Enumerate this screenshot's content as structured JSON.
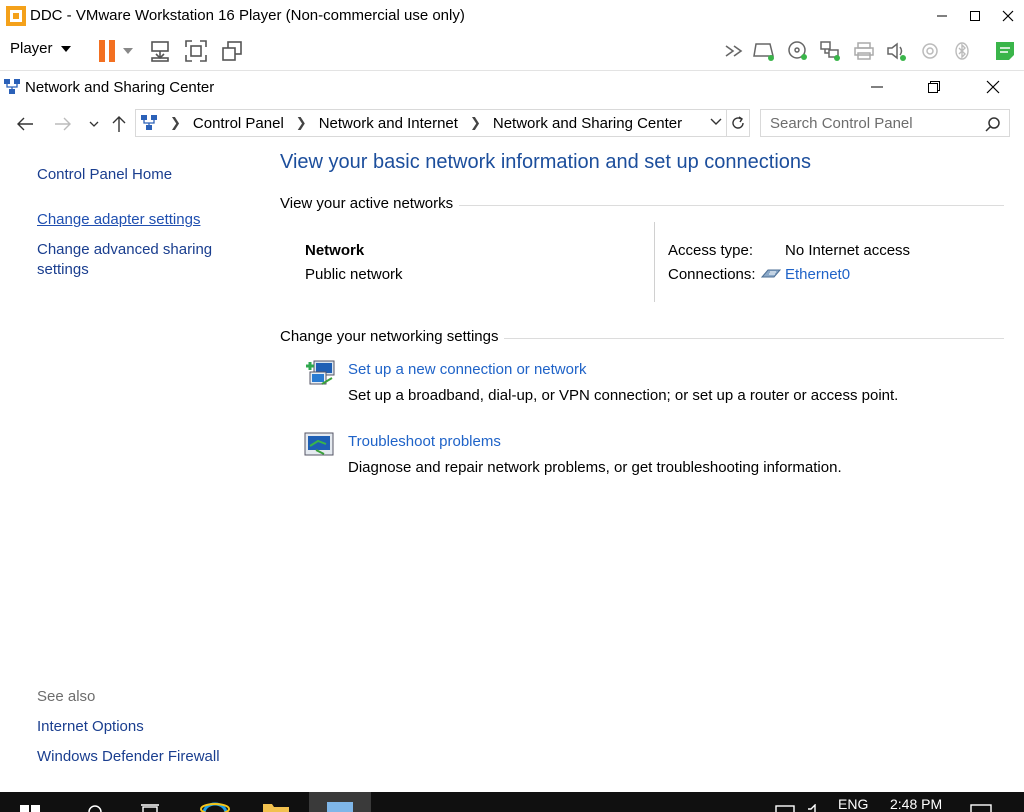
{
  "vm": {
    "title": "DDC - VMware Workstation 16 Player (Non-commercial use only)",
    "player_menu": "Player"
  },
  "window": {
    "title": "Network and Sharing Center"
  },
  "address": {
    "breadcrumbs": [
      "Control Panel",
      "Network and Internet",
      "Network and Sharing Center"
    ],
    "search_placeholder": "Search Control Panel"
  },
  "left_pane": {
    "home": "Control Panel Home",
    "change_adapter": "Change adapter settings",
    "change_advanced_line1": "Change advanced sharing",
    "change_advanced_line2": "settings",
    "see_also": "See also",
    "internet_options": "Internet Options",
    "firewall": "Windows Defender Firewall"
  },
  "main": {
    "heading": "View your basic network information and set up connections",
    "active_networks_title": "View your active networks",
    "network_name": "Network",
    "network_type": "Public network",
    "access_type_label": "Access type:",
    "access_type_value": "No Internet access",
    "connections_label": "Connections:",
    "connections_value": "Ethernet0",
    "change_settings_title": "Change your networking settings",
    "setup_link": "Set up a new connection or network",
    "setup_desc": "Set up a broadband, dial-up, or VPN connection; or set up a router or access point.",
    "troubleshoot_link": "Troubleshoot problems",
    "troubleshoot_desc": "Diagnose and repair network problems, or get troubleshooting information."
  },
  "taskbar": {
    "language": "ENG",
    "time": "2:48 PM"
  },
  "colors": {
    "heading_blue": "#1c4e9c",
    "link_blue": "#1f63c8",
    "pause_orange": "#f37021",
    "unity_green": "#3ab54a"
  }
}
